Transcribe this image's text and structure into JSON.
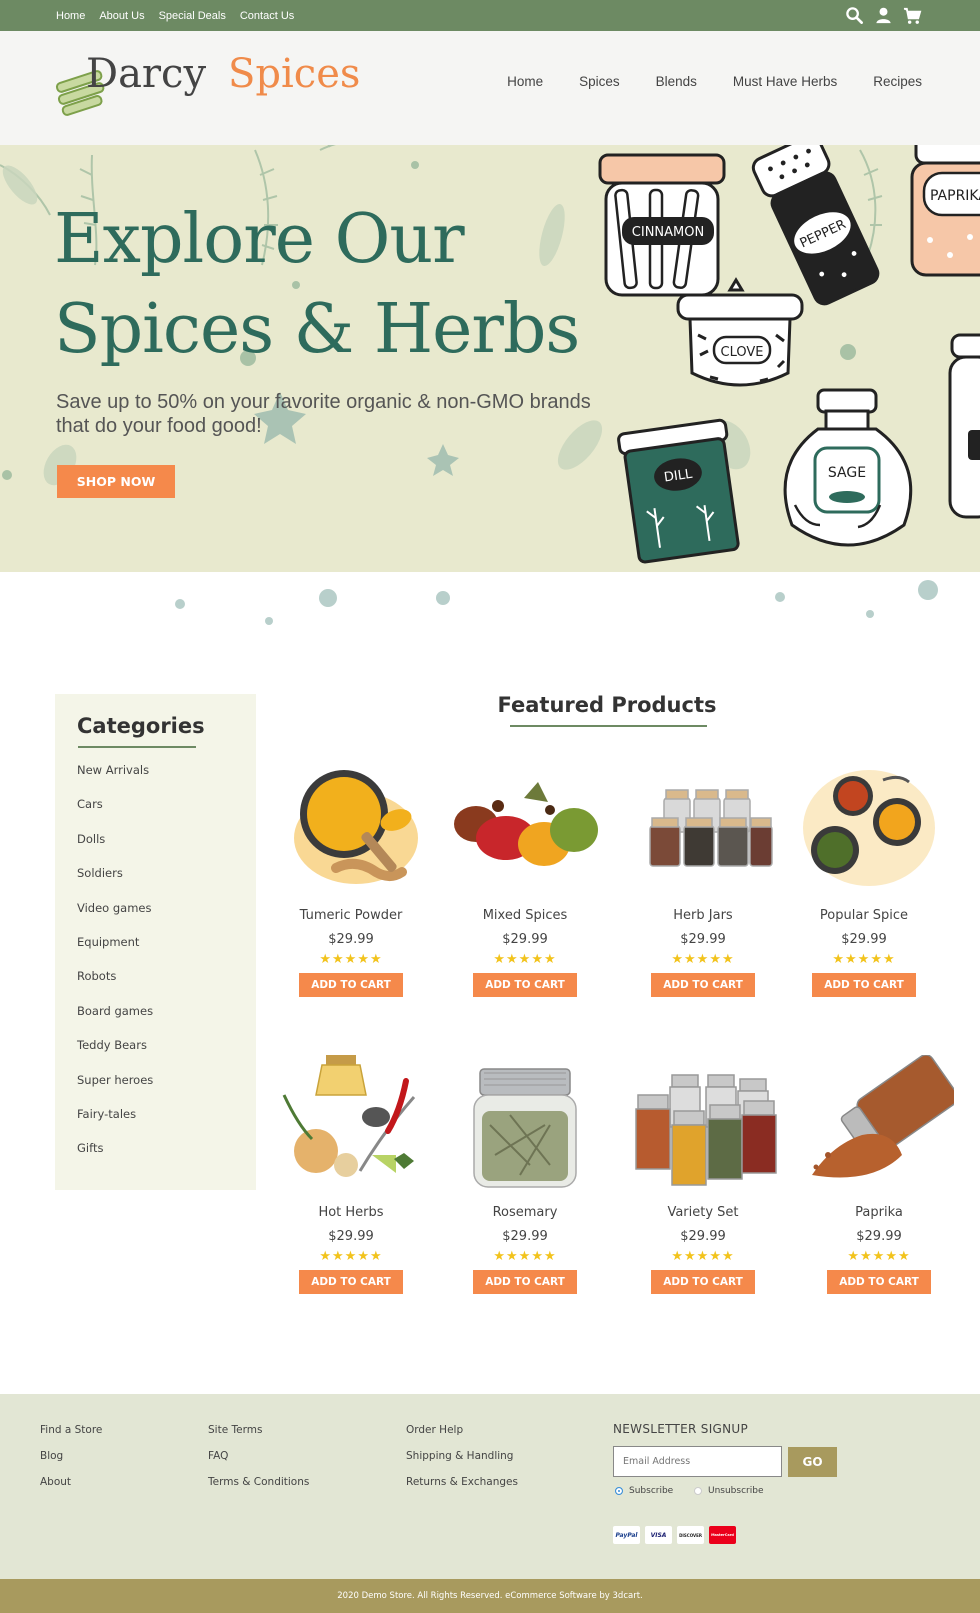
{
  "topbar": {
    "links": [
      "Home",
      "About Us",
      "Special Deals",
      "Contact Us"
    ],
    "icons": [
      "search-icon",
      "user-icon",
      "cart-icon"
    ]
  },
  "header": {
    "logo_word1": "Darcy",
    "logo_word2": "Spices",
    "nav": [
      "Home",
      "Spices",
      "Blends",
      "Must Have Herbs",
      "Recipes"
    ]
  },
  "hero": {
    "title_line1": "Explore Our",
    "title_line2": "Spices & Herbs",
    "subtitle": "Save up to 50% on your favorite organic & non-GMO brands that do your food good!",
    "button": "SHOP NOW",
    "jar_labels": [
      "CINNAMON",
      "PEPPER",
      "PAPRIKA",
      "CLOVE",
      "DILL",
      "SAGE"
    ]
  },
  "categories": {
    "title": "Categories",
    "items": [
      "New Arrivals",
      "Cars",
      "Dolls",
      "Soldiers",
      "Video games",
      "Equipment",
      "Robots",
      "Board games",
      "Teddy Bears",
      "Super heroes",
      "Fairy-tales",
      "Gifts"
    ]
  },
  "featured": {
    "title": "Featured Products",
    "products": [
      {
        "name": "Tumeric Powder",
        "price": "$29.99",
        "stars": "★★★★★",
        "rating": 5,
        "button": "ADD TO CART"
      },
      {
        "name": "Mixed Spices",
        "price": "$29.99",
        "stars": "★★★★★",
        "rating": 5,
        "button": "ADD TO CART"
      },
      {
        "name": "Herb Jars",
        "price": "$29.99",
        "stars": "★★★★★",
        "rating": 5,
        "button": "ADD TO CART"
      },
      {
        "name": "Popular Spice",
        "price": "$29.99",
        "stars": "★★★★★",
        "rating": 5,
        "button": "ADD TO CART"
      },
      {
        "name": "Hot Herbs",
        "price": "$29.99",
        "stars": "★★★★★",
        "rating": 5,
        "button": "ADD TO CART"
      },
      {
        "name": "Rosemary",
        "price": "$29.99",
        "stars": "★★★★★",
        "rating": 5,
        "button": "ADD TO CART"
      },
      {
        "name": "Variety Set",
        "price": "$29.99",
        "stars": "★★★★★",
        "rating": 5,
        "button": "ADD TO CART"
      },
      {
        "name": "Paprika",
        "price": "$29.99",
        "stars": "★★★★★",
        "rating": 5,
        "button": "ADD TO CART"
      }
    ]
  },
  "footer": {
    "col1": [
      "Find a Store",
      "Blog",
      "About"
    ],
    "col2": [
      "Site Terms",
      "FAQ",
      "Terms & Conditions"
    ],
    "col3": [
      "Order Help",
      "Shipping & Handling",
      "Returns & Exchanges"
    ],
    "newsletter_title": "NEWSLETTER SIGNUP",
    "email_placeholder": "Email Address",
    "go_button": "GO",
    "subscribe": "Subscribe",
    "unsubscribe": "Unsubscribe",
    "payments": [
      "PayPal",
      "VISA",
      "DISCOVER",
      "MasterCard"
    ],
    "copyright": "2020  Demo Store. All Rights Reserved. eCommerce Software by 3dcart."
  },
  "colors": {
    "green": "#6d8a63",
    "orange": "#f5894b",
    "hero_bg": "#e8e9ce",
    "teal": "#2e6b5c",
    "gold": "#a89a5e"
  }
}
